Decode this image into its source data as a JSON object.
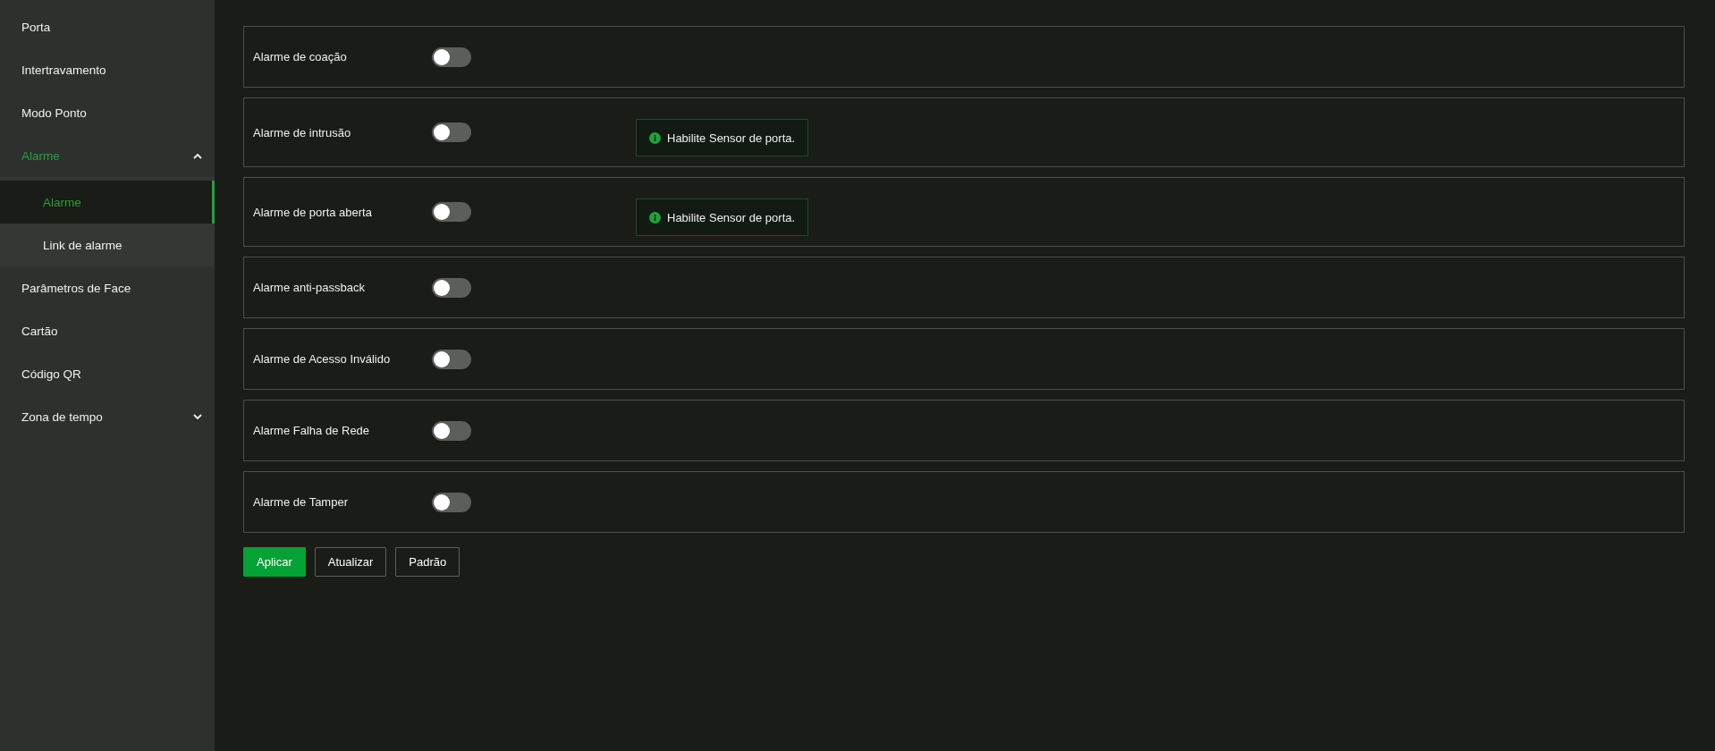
{
  "sidebar": {
    "items": [
      {
        "label": "Porta",
        "selected": false
      },
      {
        "label": "Intertravamento",
        "selected": false
      },
      {
        "label": "Modo Ponto",
        "selected": false
      },
      {
        "label": "Alarme",
        "selected": true,
        "expanded": true,
        "children": [
          {
            "label": "Alarme",
            "selected": true
          },
          {
            "label": "Link de alarme",
            "selected": false
          }
        ]
      },
      {
        "label": "Parâmetros de Face",
        "selected": false
      },
      {
        "label": "Cartão",
        "selected": false
      },
      {
        "label": "Código QR",
        "selected": false
      },
      {
        "label": "Zona de tempo",
        "selected": false,
        "expanded": false
      }
    ]
  },
  "alarms": [
    {
      "label": "Alarme de coação",
      "on": false
    },
    {
      "label": "Alarme de intrusão",
      "on": false,
      "note": "Habilite Sensor de porta."
    },
    {
      "label": "Alarme de porta aberta",
      "on": false,
      "note": "Habilite Sensor de porta."
    },
    {
      "label": "Alarme anti-passback",
      "on": false
    },
    {
      "label": "Alarme de Acesso Inválido",
      "on": false
    },
    {
      "label": "Alarme Falha de Rede",
      "on": false
    },
    {
      "label": "Alarme de Tamper",
      "on": false
    }
  ],
  "buttons": [
    {
      "label": "Aplicar",
      "kind": "primary"
    },
    {
      "label": "Atualizar",
      "kind": "secondary"
    },
    {
      "label": "Padrão",
      "kind": "secondary"
    }
  ]
}
